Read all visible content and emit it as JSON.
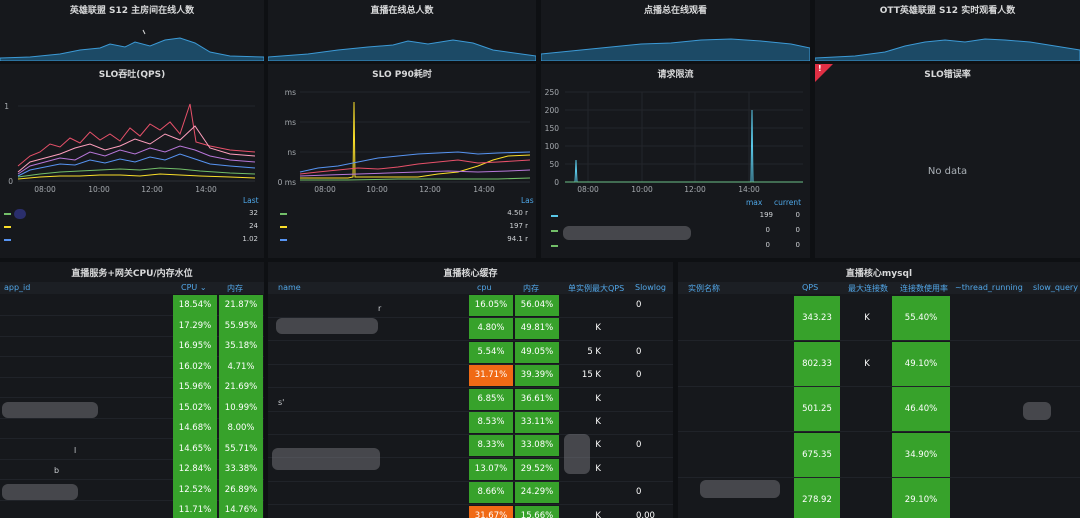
{
  "top_panels": [
    {
      "title": "英雄联盟 S12 主房间在线人数"
    },
    {
      "title": "直播在线总人数"
    },
    {
      "title": "点播总在线观看"
    },
    {
      "title": "OTT英雄联盟 S12 实时观看人数"
    }
  ],
  "qps_panel": {
    "title": "SLO吞吐(QPS)",
    "y_ticks": [
      "1",
      "0"
    ],
    "x_ticks": [
      "08:00",
      "10:00",
      "12:00",
      "14:00"
    ],
    "legend_header": "Last",
    "legend_values": [
      "32",
      "24",
      "1.02"
    ],
    "legend_colors": [
      "#73bf69",
      "#fade2a",
      "#5794f2"
    ]
  },
  "p90_panel": {
    "title": "SLO P90耗时",
    "y_ticks": [
      "ms",
      "ms",
      "ns",
      "0 ms"
    ],
    "x_ticks": [
      "08:00",
      "10:00",
      "12:00",
      "14:00"
    ],
    "legend_header": "Las",
    "legend_values": [
      "4.50 r",
      "197 r",
      "94.1 r"
    ],
    "legend_colors": [
      "#73bf69",
      "#fade2a",
      "#5794f2"
    ]
  },
  "limit_panel": {
    "title": "请求限流",
    "y_ticks": [
      "250",
      "200",
      "150",
      "100",
      "50",
      "0"
    ],
    "x_ticks": [
      "08:00",
      "10:00",
      "12:00",
      "14:00"
    ],
    "legend_max_label": "max",
    "legend_current_label": "current",
    "legend_rows": [
      {
        "max": "199",
        "current": "0",
        "color": "#5ac8e8"
      },
      {
        "max": "0",
        "current": "0",
        "color": "#73bf69"
      },
      {
        "max": "0",
        "current": "0",
        "color": "#73bf69"
      }
    ]
  },
  "error_panel": {
    "title": "SLO错误率",
    "flag": "!",
    "empty_text": "No data"
  },
  "cpu_table": {
    "title": "直播服务+网关CPU/内存水位",
    "headers": {
      "app_id": "app_id",
      "cpu": "CPU",
      "mem": "内存"
    },
    "rows": [
      {
        "cpu": "18.54%",
        "mem": "21.87%"
      },
      {
        "cpu": "17.29%",
        "mem": "55.95%"
      },
      {
        "cpu": "16.95%",
        "mem": "35.18%"
      },
      {
        "cpu": "16.02%",
        "mem": "4.71%"
      },
      {
        "cpu": "15.96%",
        "mem": "21.69%"
      },
      {
        "cpu": "15.02%",
        "mem": "10.99%"
      },
      {
        "cpu": "14.68%",
        "mem": "8.00%"
      },
      {
        "cpu": "14.65%",
        "mem": "55.71%"
      },
      {
        "cpu": "12.84%",
        "mem": "33.38%"
      },
      {
        "cpu": "12.52%",
        "mem": "26.89%"
      },
      {
        "cpu": "11.71%",
        "mem": "14.76%"
      }
    ],
    "partial_text": [
      "l",
      "b"
    ]
  },
  "cache_table": {
    "title": "直播核心缓存",
    "headers": {
      "name": "name",
      "cpu": "cpu",
      "mem": "内存",
      "qps": "单实例最大QPS",
      "slowlog": "Slowlog"
    },
    "rows": [
      {
        "cpu": "16.05%",
        "mem": "56.04%",
        "qps": "",
        "slow": "0",
        "cpu_alert": false
      },
      {
        "cpu": "4.80%",
        "mem": "49.81%",
        "qps": "K",
        "slow": "",
        "cpu_alert": false
      },
      {
        "cpu": "5.54%",
        "mem": "49.05%",
        "qps": "5 K",
        "slow": "0",
        "cpu_alert": false
      },
      {
        "cpu": "31.71%",
        "mem": "39.39%",
        "qps": "15 K",
        "slow": "0",
        "cpu_alert": true
      },
      {
        "cpu": "6.85%",
        "mem": "36.61%",
        "qps": "K",
        "slow": "",
        "cpu_alert": false
      },
      {
        "cpu": "8.53%",
        "mem": "33.11%",
        "qps": "K",
        "slow": "",
        "cpu_alert": false
      },
      {
        "cpu": "8.33%",
        "mem": "33.08%",
        "qps": "K",
        "slow": "0",
        "cpu_alert": false
      },
      {
        "cpu": "13.07%",
        "mem": "29.52%",
        "qps": "K",
        "slow": "",
        "cpu_alert": false
      },
      {
        "cpu": "8.66%",
        "mem": "24.29%",
        "qps": "",
        "slow": "0",
        "cpu_alert": false
      },
      {
        "cpu": "31.67%",
        "mem": "15.66%",
        "qps": "K",
        "slow": "0.00",
        "cpu_alert": true
      }
    ],
    "partial_text": [
      "r",
      "s'"
    ]
  },
  "mysql_table": {
    "title": "直播核心mysql",
    "headers": {
      "name": "实例名称",
      "qps": "QPS",
      "maxconn": "最大连接数",
      "usage": "连接数使用率",
      "thread": "~thread_running",
      "slow": "slow_query"
    },
    "rows": [
      {
        "qps": "343.23",
        "maxconn": "K",
        "usage": "55.40%"
      },
      {
        "qps": "802.33",
        "maxconn": "K",
        "usage": "49.10%"
      },
      {
        "qps": "501.25",
        "maxconn": "",
        "usage": "46.40%"
      },
      {
        "qps": "675.35",
        "maxconn": "",
        "usage": "34.90%"
      },
      {
        "qps": "278.92",
        "maxconn": "",
        "usage": "29.10%"
      }
    ]
  }
}
